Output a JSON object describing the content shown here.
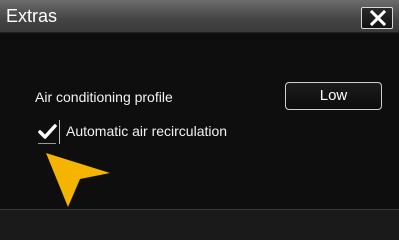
{
  "window": {
    "title": "Extras"
  },
  "settings": {
    "ac_profile_label": "Air conditioning profile",
    "ac_profile_value": "Low",
    "recirculation_label": "Automatic air recirculation",
    "recirculation_checked": true
  },
  "icons": {
    "close": "close-icon",
    "check": "checkmark-icon",
    "pointer": "pointer-arrow-icon"
  },
  "colors": {
    "accent_pointer": "#f5b400",
    "background": "#0e0e0e",
    "title_bar": "#555555"
  }
}
